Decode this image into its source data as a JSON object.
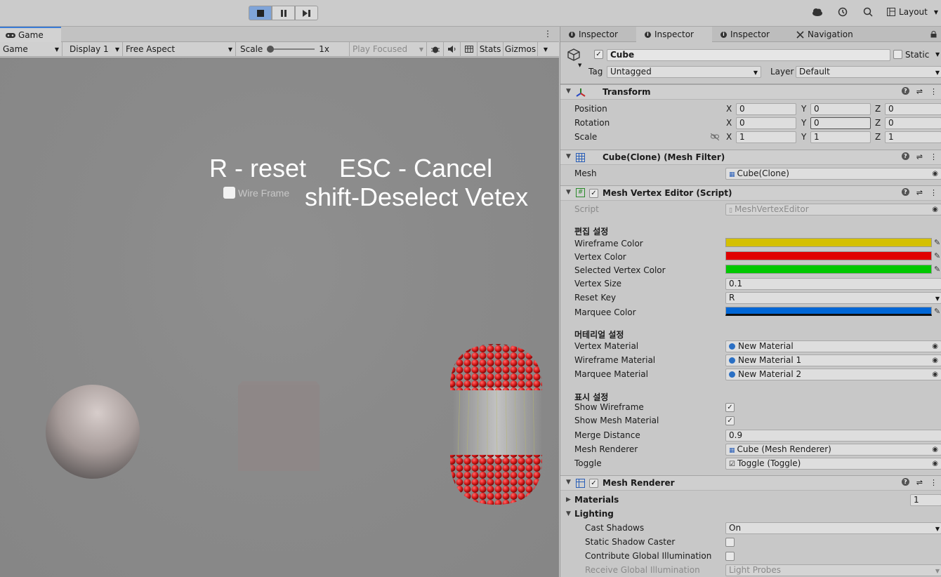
{
  "toolbar": {
    "layout_label": "Layout"
  },
  "game": {
    "tab_label": "Game",
    "display_mode": "Game",
    "display": "Display 1",
    "aspect": "Free Aspect",
    "scale_label": "Scale",
    "scale_value": "1x",
    "play_focused": "Play Focused",
    "stats": "Stats",
    "gizmos": "Gizmos",
    "overlay": {
      "reset_text": "R - reset",
      "cancel_text": "ESC - Cancel",
      "deselect_text": "shift-Deselect Vetex",
      "wireframe_label": "Wire Frame"
    }
  },
  "inspector": {
    "tabs": [
      "Inspector",
      "Inspector",
      "Inspector",
      "Navigation"
    ],
    "object_name": "Cube",
    "static_label": "Static",
    "tag_label": "Tag",
    "tag_value": "Untagged",
    "layer_label": "Layer",
    "layer_value": "Default",
    "transform": {
      "title": "Transform",
      "position_label": "Position",
      "rotation_label": "Rotation",
      "scale_label": "Scale",
      "position": [
        "0",
        "0",
        "0"
      ],
      "rotation": [
        "0",
        "0",
        "0"
      ],
      "scale": [
        "1",
        "1",
        "1"
      ],
      "axes": [
        "X",
        "Y",
        "Z"
      ]
    },
    "mesh_filter": {
      "title": "Cube(Clone) (Mesh Filter)",
      "mesh_label": "Mesh",
      "mesh_value": "Cube(Clone)"
    },
    "vertex_editor": {
      "title": "Mesh Vertex Editor (Script)",
      "script_label": "Script",
      "script_value": "MeshVertexEditor",
      "edit_section": "편집 설정",
      "wireframe_color_label": "Wireframe Color",
      "vertex_color_label": "Vertex Color",
      "selected_vertex_color_label": "Selected Vertex Color",
      "vertex_size_label": "Vertex Size",
      "vertex_size_value": "0.1",
      "reset_key_label": "Reset Key",
      "reset_key_value": "R",
      "marquee_color_label": "Marquee Color",
      "material_section": "머테리얼 설정",
      "vertex_material_label": "Vertex Material",
      "vertex_material_value": "New Material",
      "wireframe_material_label": "Wireframe Material",
      "wireframe_material_value": "New Material 1",
      "marquee_material_label": "Marquee Material",
      "marquee_material_value": "New Material 2",
      "display_section": "표시 설정",
      "show_wireframe_label": "Show Wireframe",
      "show_mesh_material_label": "Show Mesh Material",
      "merge_distance_label": "Merge Distance",
      "merge_distance_value": "0.9",
      "mesh_renderer_label": "Mesh Renderer",
      "mesh_renderer_value": "Cube (Mesh Renderer)",
      "toggle_label": "Toggle",
      "toggle_value": "Toggle (Toggle)"
    },
    "mesh_renderer": {
      "title": "Mesh Renderer",
      "materials_label": "Materials",
      "materials_count": "1",
      "lighting_label": "Lighting",
      "cast_shadows_label": "Cast Shadows",
      "cast_shadows_value": "On",
      "static_shadow_caster_label": "Static Shadow Caster",
      "contribute_gi_label": "Contribute Global Illumination",
      "receive_gi_label": "Receive Global Illumination",
      "receive_gi_value": "Light Probes"
    }
  },
  "colors": {
    "wireframe": "#d4c000",
    "vertex": "#e00000",
    "selected_vertex": "#00c800",
    "marquee": "#0066d6"
  }
}
